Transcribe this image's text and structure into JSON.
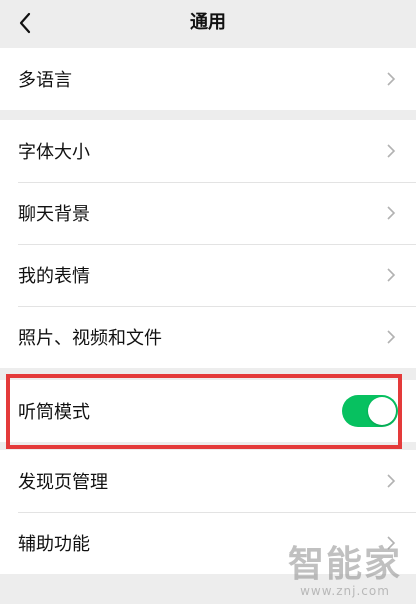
{
  "header": {
    "title": "通用",
    "back_icon": "chevron-left-icon"
  },
  "groups": [
    {
      "items": [
        {
          "label": "多语言",
          "type": "link"
        }
      ]
    },
    {
      "items": [
        {
          "label": "字体大小",
          "type": "link"
        },
        {
          "label": "聊天背景",
          "type": "link"
        },
        {
          "label": "我的表情",
          "type": "link"
        },
        {
          "label": "照片、视频和文件",
          "type": "link"
        }
      ]
    },
    {
      "items": [
        {
          "label": "听筒模式",
          "type": "toggle",
          "on": true
        }
      ]
    },
    {
      "items": [
        {
          "label": "发现页管理",
          "type": "link"
        },
        {
          "label": "辅助功能",
          "type": "link"
        }
      ]
    }
  ],
  "colors": {
    "background": "#ededed",
    "toggle_on": "#07c160",
    "highlight_border": "#e43a3a"
  },
  "watermark": {
    "text": "智能家",
    "url": "www.znj.com"
  }
}
